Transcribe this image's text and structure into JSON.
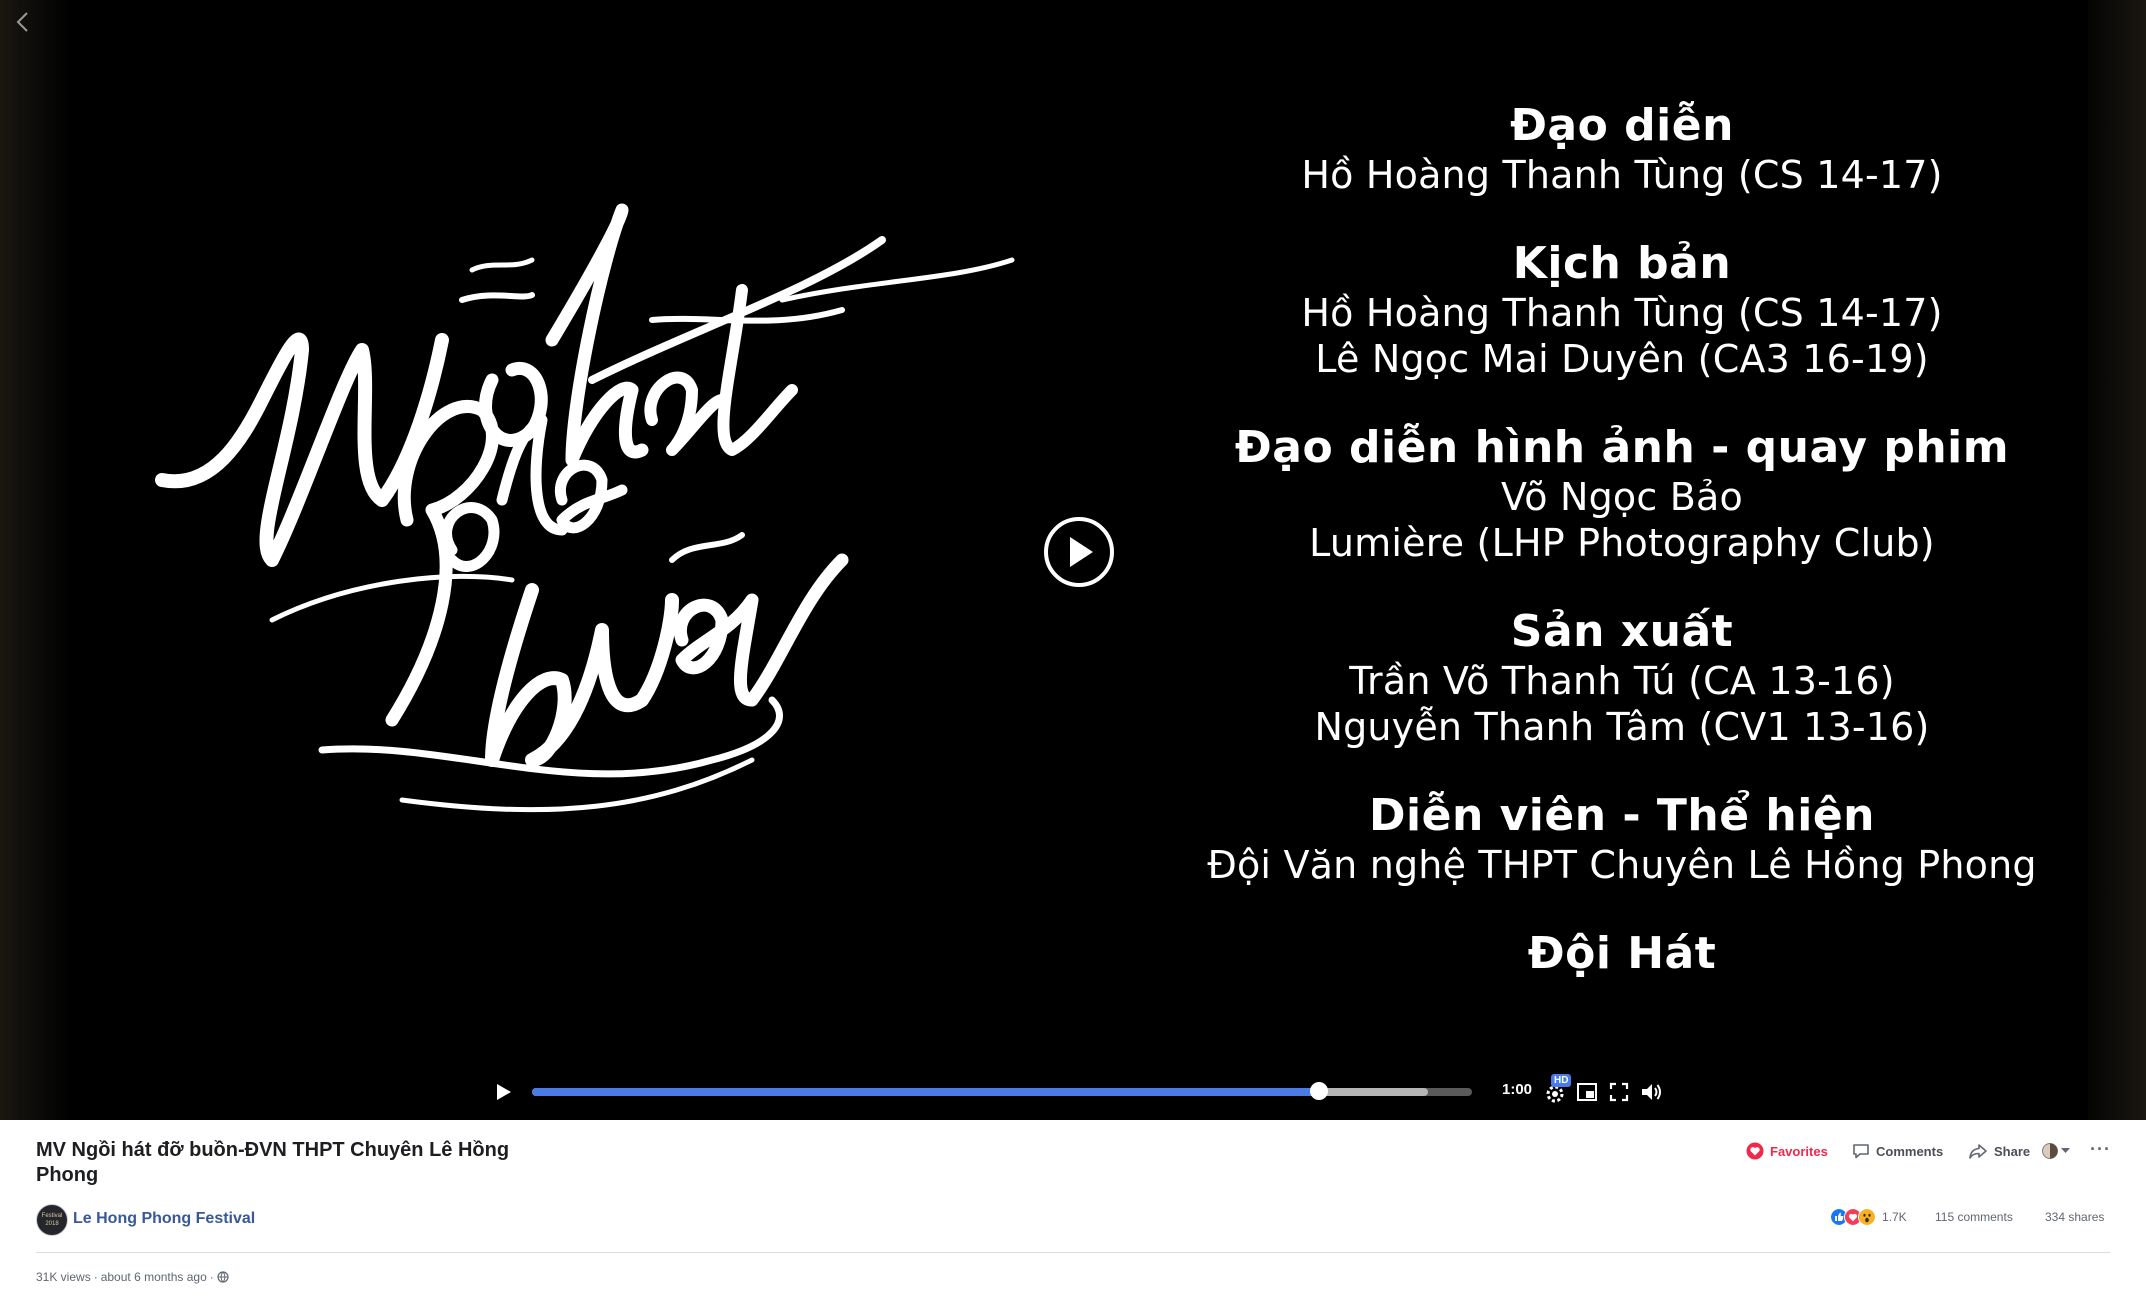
{
  "player": {
    "title_art_text": "Ngồi hát đỡ buồn",
    "credits": [
      {
        "role": "Đạo diễn",
        "names": [
          "Hồ Hoàng Thanh Tùng (CS 14-17)"
        ]
      },
      {
        "role": "Kịch bản",
        "names": [
          "Hồ Hoàng Thanh Tùng (CS 14-17)",
          "Lê Ngọc Mai Duyên (CA3 16-19)"
        ]
      },
      {
        "role": "Đạo diễn hình ảnh - quay phim",
        "names": [
          "Võ Ngọc Bảo",
          "Lumière (LHP Photography Club)"
        ]
      },
      {
        "role": "Sản xuất",
        "names": [
          "Trần Võ Thanh Tú (CA 13-16)",
          "Nguyễn Thanh Tâm (CV1 13-16)"
        ]
      },
      {
        "role": "Diễn viên - Thể hiện",
        "names": [
          "Đội Văn nghệ THPT Chuyên Lê Hồng Phong"
        ]
      },
      {
        "role": "Đội Hát",
        "names": []
      }
    ],
    "time": "1:00",
    "hd_label": "HD",
    "progress_played": 0.837,
    "progress_buffered": 0.953,
    "accent_color": "#4b7be5"
  },
  "video": {
    "title": "MV Ngồi hát đỡ buồn-ĐVN THPT Chuyên Lê Hồng Phong",
    "page_name": "Le Hong Phong Festival",
    "avatar_text": "Festival 2018",
    "views": "31K views",
    "posted": "about 6 months ago",
    "meta_separator": "·"
  },
  "actions": {
    "favorites": "Favorites",
    "comments": "Comments",
    "share": "Share",
    "more": "···"
  },
  "stats": {
    "reactions": "1.7K",
    "comments": "115 comments",
    "shares": "334 shares"
  },
  "colors": {
    "favorites": "#f02849",
    "link": "#385898",
    "like": "#1877f2",
    "love": "#f33e58",
    "wow": "#f7b125"
  },
  "icons": [
    "back-arrow-icon",
    "play-icon",
    "settings-icon",
    "pip-icon",
    "fullscreen-icon",
    "volume-icon",
    "heart-icon",
    "comment-icon",
    "share-arrow-icon",
    "globe-icon"
  ]
}
